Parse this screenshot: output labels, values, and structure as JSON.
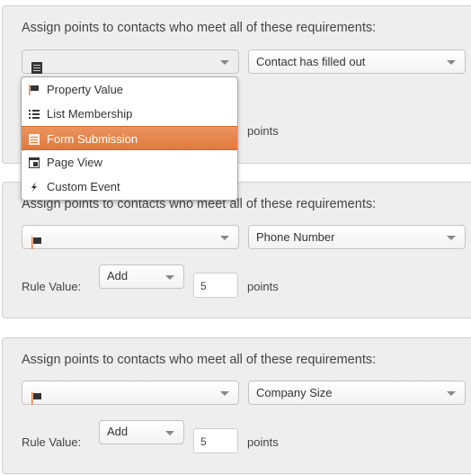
{
  "heading": "Assign points to contacts who meet all of these requirements:",
  "rule_label": "Rule Value:",
  "points_label": "points",
  "accent": "#e5813f",
  "rules": [
    {
      "type_icon": "form-icon",
      "condition": "Contact has filled out"
    },
    {
      "type_icon": "flag-icon",
      "condition": "Phone Number",
      "operation": "Add",
      "value": "5"
    },
    {
      "type_icon": "flag-icon",
      "condition": "Company Size",
      "operation": "Add",
      "value": "5"
    }
  ],
  "dropdown": {
    "items": [
      {
        "label": "Property Value",
        "icon": "flag-icon"
      },
      {
        "label": "List Membership",
        "icon": "list-icon"
      },
      {
        "label": "Form Submission",
        "icon": "form-icon",
        "highlighted": true
      },
      {
        "label": "Page View",
        "icon": "page-icon"
      },
      {
        "label": "Custom Event",
        "icon": "bolt-icon"
      }
    ]
  }
}
